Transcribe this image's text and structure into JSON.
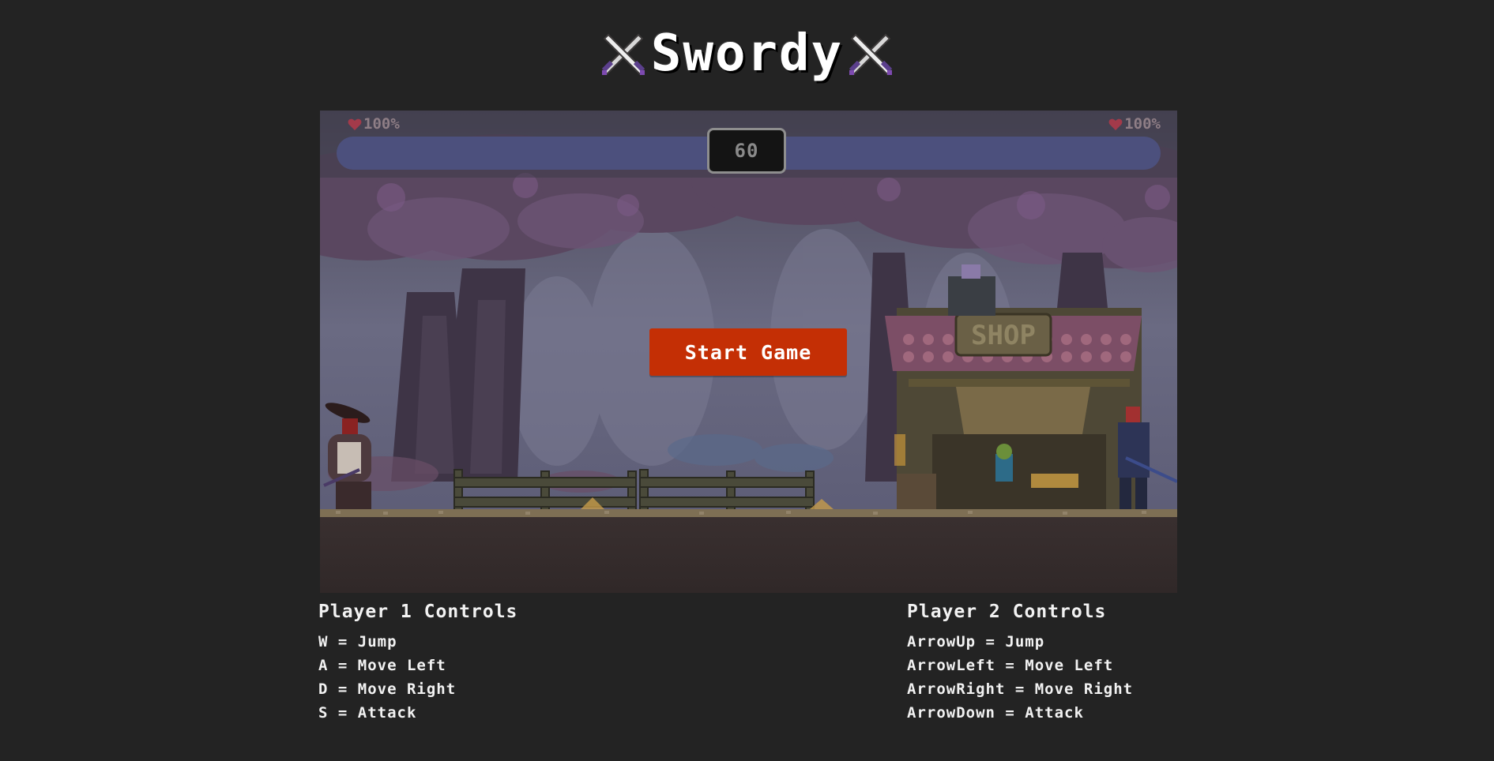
{
  "game": {
    "title": "Swordy",
    "start_label": "Start Game",
    "timer": "60",
    "player1": {
      "health_text": "100%",
      "health": 1.0
    },
    "player2": {
      "health_text": "100%",
      "health": 1.0
    },
    "shop_sign": "SHOP"
  },
  "controls": {
    "player1": {
      "heading": "Player 1 Controls",
      "items": [
        "W = Jump",
        "A = Move Left",
        "D = Move Right",
        "S = Attack"
      ]
    },
    "player2": {
      "heading": "Player 2 Controls",
      "items": [
        "ArrowUp = Jump",
        "ArrowLeft = Move Left",
        "ArrowRight = Move Right",
        "ArrowDown = Attack"
      ]
    }
  },
  "colors": {
    "page_background": "#232323",
    "start_button": "#c42f05",
    "health_bar": "#4c507d",
    "heart": "#a33a4a"
  },
  "icons": {
    "title_decoration": "crossed-swords-icon",
    "health": "heart-icon"
  }
}
